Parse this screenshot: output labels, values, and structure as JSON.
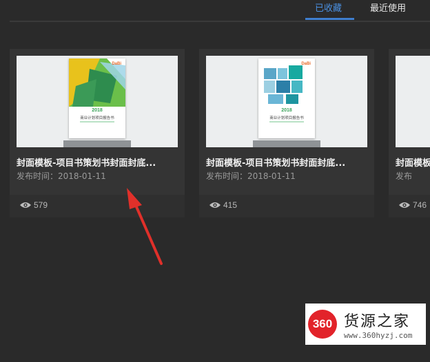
{
  "tabs": [
    {
      "label": "已收藏",
      "active": true
    },
    {
      "label": "最近使用",
      "active": false
    }
  ],
  "cards": [
    {
      "title": "封面模板-项目书策划书封面封底...",
      "date": "发布时间：2018-01-11",
      "views": "579",
      "book_year": "2018",
      "book_title": "商业计划项目报告书",
      "book_logo": "DaBi"
    },
    {
      "title": "封面模板-项目书策划书封面封底...",
      "date": "发布时间：2018-01-11",
      "views": "415",
      "book_year": "2018",
      "book_title": "商业计划项目报告书",
      "book_logo": "DaBi"
    },
    {
      "title": "封面模板",
      "date": "发布",
      "views": "746"
    }
  ],
  "watermark": {
    "logo": "360",
    "name": "货源之家",
    "url": "www.360hyzj.com"
  },
  "colors": {
    "background": "#2a2a2a",
    "card": "#343434",
    "active_tab": "#4a90e2",
    "arrow": "#e0302a"
  }
}
